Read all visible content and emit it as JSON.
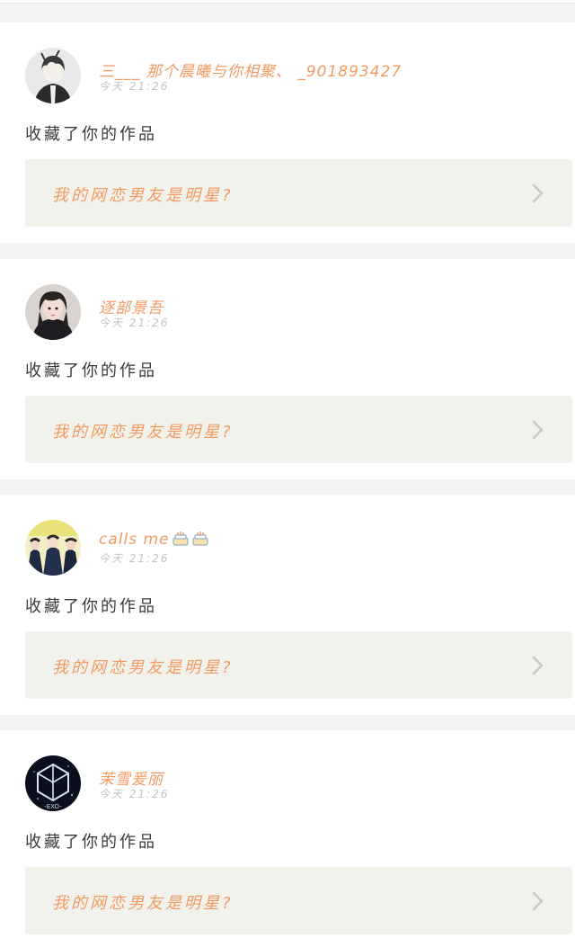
{
  "feed": {
    "items": [
      {
        "username": "三___ 那个晨曦与你相聚、 _901893427",
        "timestamp": "今天 21:26",
        "action": "收藏了你的作品",
        "work_title": "我的网恋男友是明星?",
        "avatar": "avatar-anime-boy"
      },
      {
        "username": "逐部景吾",
        "timestamp": "今天 21:26",
        "action": "收藏了你的作品",
        "work_title": "我的网恋男友是明星?",
        "avatar": "avatar-girl-photo"
      },
      {
        "username": "calls me",
        "username_emojis": [
          "cake-icon",
          "cake-icon"
        ],
        "timestamp": "今天 21:26",
        "action": "收藏了你的作品",
        "work_title": "我的网恋男友是明星?",
        "avatar": "avatar-group-photo"
      },
      {
        "username": "茉雪爰丽",
        "timestamp": "今天 21:26",
        "action": "收藏了你的作品",
        "work_title": "我的网恋男友是明星?",
        "avatar": "avatar-exo-logo"
      }
    ]
  },
  "colors": {
    "accent": "#f29a63",
    "background": "#f4f4f2",
    "card": "#ffffff",
    "link_bg": "#f2f2ec",
    "text": "#3a3a3a",
    "muted": "#c2c2c2"
  }
}
